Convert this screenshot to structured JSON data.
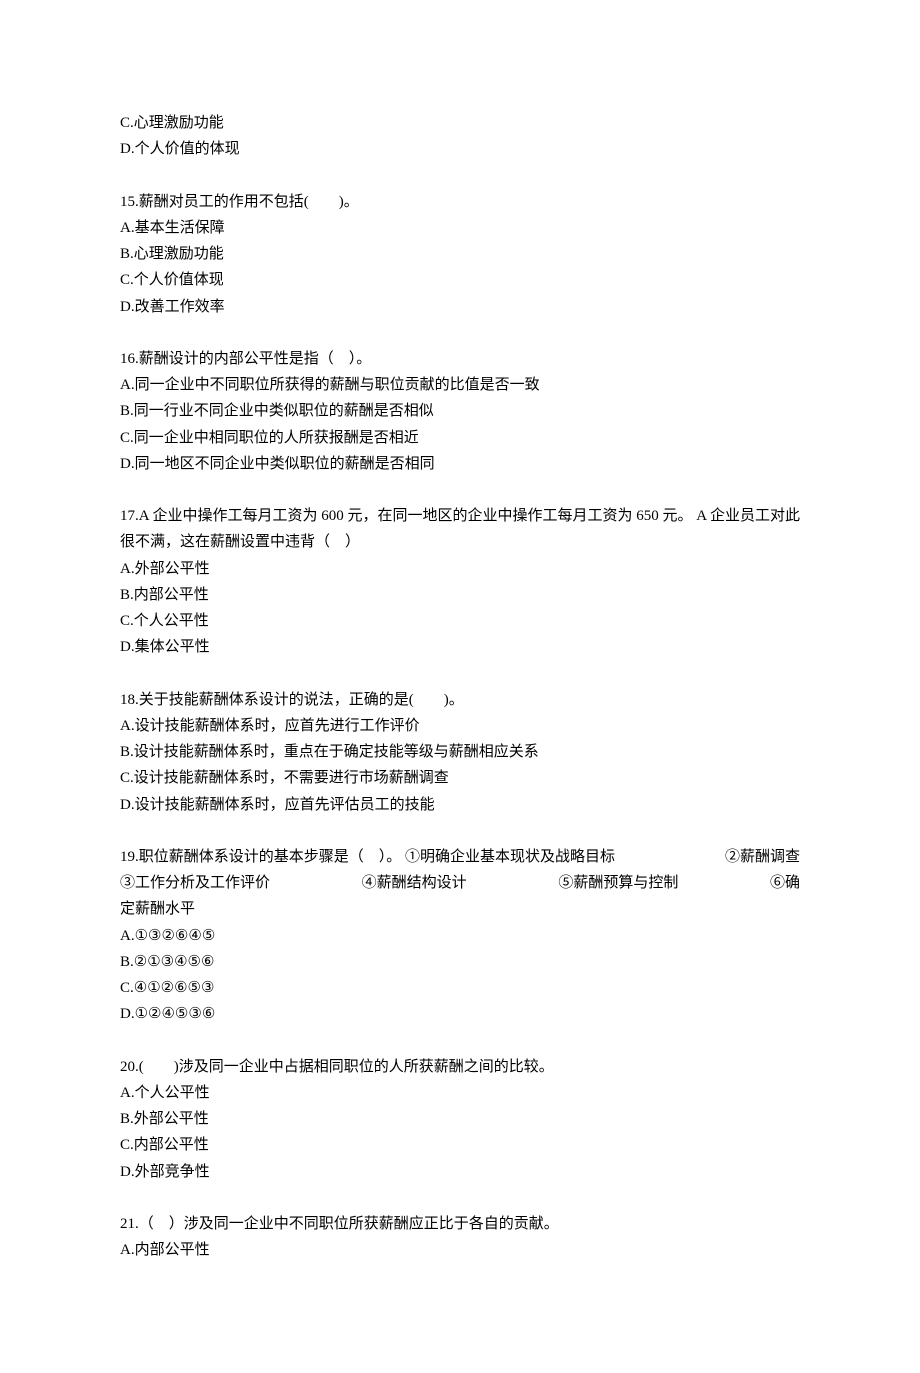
{
  "partial_q14": {
    "opt_c": "C.心理激励功能",
    "opt_d": "D.个人价值的体现"
  },
  "q15": {
    "stem": "15.薪酬对员工的作用不包括(　　)。",
    "a": "A.基本生活保障",
    "b": "B.心理激励功能",
    "c": "C.个人价值体现",
    "d": "D.改善工作效率"
  },
  "q16": {
    "stem": "16.薪酬设计的内部公平性是指（　）。",
    "a": "A.同一企业中不同职位所获得的薪酬与职位贡献的比值是否一致",
    "b": "B.同一行业不同企业中类似职位的薪酬是否相似",
    "c": "C.同一企业中相同职位的人所获报酬是否相近",
    "d": "D.同一地区不同企业中类似职位的薪酬是否相同"
  },
  "q17": {
    "stem": "17.A 企业中操作工每月工资为 600 元，在同一地区的企业中操作工每月工资为 650 元。 A 企业员工对此很不满，这在薪酬设置中违背（　）",
    "a": "A.外部公平性",
    "b": "B.内部公平性",
    "c": "C.个人公平性",
    "d": "D.集体公平性"
  },
  "q18": {
    "stem": "18.关于技能薪酬体系设计的说法，正确的是(　　)。",
    "a": "A.设计技能薪酬体系时，应首先进行工作评价",
    "b": "B.设计技能薪酬体系时，重点在于确定技能等级与薪酬相应关系",
    "c": "C.设计技能薪酬体系时，不需要进行市场薪酬调查",
    "d": "D.设计技能薪酬体系时，应首先评估员工的技能"
  },
  "q19": {
    "stem_line1_a": "19.职位薪酬体系设计的基本步骤是（　）。 ①明确企业基本现状及战略目标",
    "stem_line1_b": "②薪酬调查",
    "stem_line2_a": "③工作分析及工作评价",
    "stem_line2_b": "④薪酬结构设计",
    "stem_line2_c": "⑤薪酬预算与控制",
    "stem_line2_d": "⑥确",
    "stem_line3": "定薪酬水平",
    "a": "A.①③②⑥④⑤",
    "b": "B.②①③④⑤⑥",
    "c": "C.④①②⑥⑤③",
    "d": "D.①②④⑤③⑥"
  },
  "q20": {
    "stem": "20.(　　)涉及同一企业中占据相同职位的人所获薪酬之间的比较。",
    "a": "A.个人公平性",
    "b": "B.外部公平性",
    "c": "C.内部公平性",
    "d": "D.外部竞争性"
  },
  "q21": {
    "stem": "21.（　）涉及同一企业中不同职位所获薪酬应正比于各自的贡献。",
    "a": "A.内部公平性"
  }
}
